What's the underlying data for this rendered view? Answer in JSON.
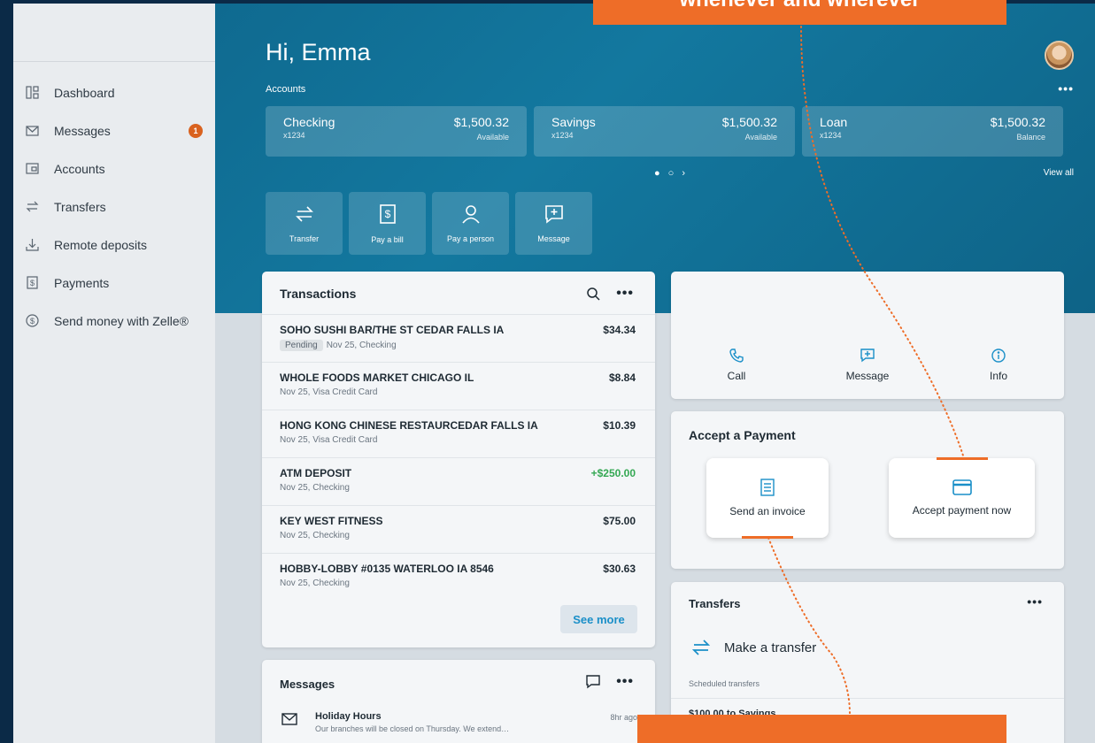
{
  "callouts": {
    "top": "whenever and wherever",
    "bottom": ""
  },
  "sidebar": {
    "items": [
      {
        "label": "Dashboard",
        "icon": "dashboard-icon"
      },
      {
        "label": "Messages",
        "icon": "mail-icon",
        "badge": "1"
      },
      {
        "label": "Accounts",
        "icon": "wallet-icon"
      },
      {
        "label": "Transfers",
        "icon": "transfer-icon"
      },
      {
        "label": "Remote deposits",
        "icon": "deposit-icon"
      },
      {
        "label": "Payments",
        "icon": "bill-icon"
      },
      {
        "label": "Send money with Zelle®",
        "icon": "zelle-icon"
      }
    ]
  },
  "header": {
    "greeting": "Hi, Emma",
    "accounts_label": "Accounts",
    "view_all": "View all"
  },
  "accounts": [
    {
      "name": "Checking",
      "number": "x1234",
      "amount": "$1,500.32",
      "amount_label": "Available"
    },
    {
      "name": "Savings",
      "number": "x1234",
      "amount": "$1,500.32",
      "amount_label": "Available"
    },
    {
      "name": "Loan",
      "number": "x1234",
      "amount": "$1,500.32",
      "amount_label": "Balance"
    }
  ],
  "pager": {
    "dot_active": "●",
    "dot_inactive": "○",
    "next": "›"
  },
  "quick_actions": [
    {
      "label": "Transfer"
    },
    {
      "label": "Pay a bill"
    },
    {
      "label": "Pay a person"
    },
    {
      "label": "Message"
    }
  ],
  "transactions": {
    "title": "Transactions",
    "pending_label": "Pending",
    "rows": [
      {
        "merchant": "SOHO SUSHI BAR/THE ST CEDAR FALLS IA",
        "detail": "Nov 25, Checking",
        "amount": "$34.34",
        "pending": true
      },
      {
        "merchant": "WHOLE FOODS MARKET CHICAGO IL",
        "detail": "Nov 25, Visa Credit Card",
        "amount": "$8.84"
      },
      {
        "merchant": "HONG KONG CHINESE RESTAURCEDAR FALLS IA",
        "detail": "Nov 25, Visa Credit Card",
        "amount": "$10.39"
      },
      {
        "merchant": "ATM DEPOSIT",
        "detail": "Nov 25, Checking",
        "amount": "+$250.00",
        "positive": true
      },
      {
        "merchant": "KEY WEST FITNESS",
        "detail": "Nov 25, Checking",
        "amount": "$75.00"
      },
      {
        "merchant": "HOBBY-LOBBY #0135 WATERLOO IA 8546",
        "detail": "Nov 25, Checking",
        "amount": "$30.63"
      }
    ],
    "see_more": "See more"
  },
  "contact": {
    "call": "Call",
    "message": "Message",
    "info": "Info"
  },
  "accept_payment": {
    "title": "Accept a Payment",
    "send_invoice": "Send an invoice",
    "accept_now": "Accept payment now"
  },
  "transfers": {
    "title": "Transfers",
    "make_transfer": "Make a transfer",
    "scheduled_label": "Scheduled transfers",
    "scheduled_item": "$100.00 to Savings"
  },
  "messages": {
    "title": "Messages",
    "item": {
      "title": "Holiday Hours",
      "preview": "Our branches will be closed on Thursday. We extend…",
      "time": "8hr ago"
    }
  },
  "colors": {
    "accent": "#ee6d28",
    "brand": "#13789f",
    "link": "#1a8fc8",
    "positive": "#34a853"
  }
}
